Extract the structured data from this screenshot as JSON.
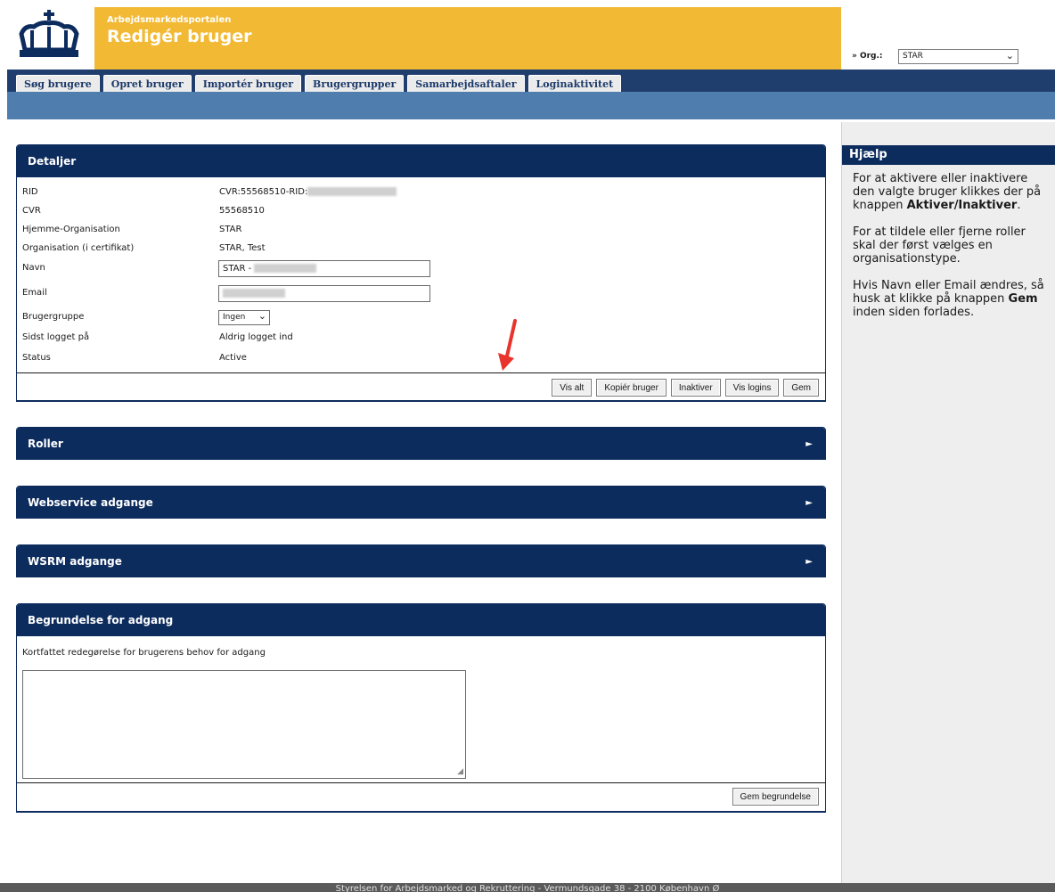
{
  "header": {
    "portal_name": "Arbejdsmarkedsportalen",
    "page_title": "Redigér bruger",
    "org_label": "» Org.:",
    "org_value": "STAR"
  },
  "tabs": [
    "Søg brugere",
    "Opret bruger",
    "Importér bruger",
    "Brugergrupper",
    "Samarbejdsaftaler",
    "Loginaktivitet"
  ],
  "details": {
    "title": "Detaljer",
    "rows": {
      "rid": {
        "label": "RID",
        "value": "CVR:55568510-RID:"
      },
      "cvr": {
        "label": "CVR",
        "value": "55568510"
      },
      "hjemme": {
        "label": "Hjemme-Organisation",
        "value": "STAR"
      },
      "org_cert": {
        "label": "Organisation (i certifikat)",
        "value": "STAR, Test"
      },
      "navn": {
        "label": "Navn",
        "value": "STAR - "
      },
      "email": {
        "label": "Email",
        "value": ""
      },
      "brugergruppe": {
        "label": "Brugergruppe",
        "value": "Ingen"
      },
      "sidst": {
        "label": "Sidst logget på",
        "value": "Aldrig logget ind"
      },
      "status": {
        "label": "Status",
        "value": "Active"
      }
    },
    "buttons": {
      "vis_alt": "Vis alt",
      "kopier": "Kopiér bruger",
      "inaktiver": "Inaktiver",
      "vis_logins": "Vis logins",
      "gem": "Gem"
    }
  },
  "panels": {
    "roller": "Roller",
    "webservice": "Webservice adgange",
    "wsrm": "WSRM adgange"
  },
  "begrundelse": {
    "title": "Begrundelse for adgang",
    "label": "Kortfattet redegørelse for brugerens behov for adgang",
    "button": "Gem begrundelse"
  },
  "help": {
    "title": "Hjælp",
    "p1_text": "For at aktivere eller inaktivere den valgte bruger klikkes der på knappen ",
    "p1_bold": "Aktiver/Inaktiver",
    "p1_end": ".",
    "p2": "For at tildele eller fjerne roller skal der først vælges en organisationstype.",
    "p3_a": "Hvis Navn eller Email ændres, så husk at klikke på knappen ",
    "p3_bold": "Gem",
    "p3_b": " inden siden forlades."
  },
  "footer": {
    "text": "Styrelsen for Arbejdsmarked og Rekruttering - Vermundsgade 38 - 2100 København Ø"
  },
  "colors": {
    "brand_yellow": "#f2b934",
    "navy": "#0d2c5e",
    "subbar_blue": "#4f7eae",
    "annotation_red": "#e8342c"
  }
}
